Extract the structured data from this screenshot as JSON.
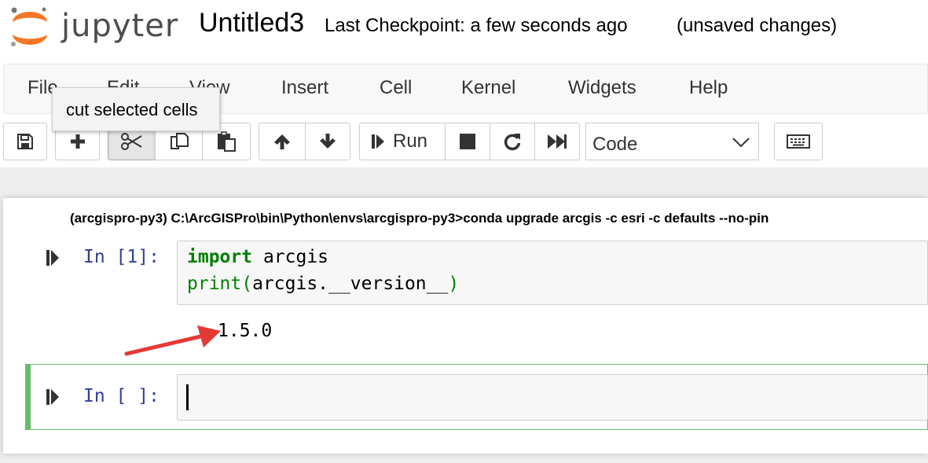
{
  "header": {
    "logo_text": "jupyter",
    "notebook_title": "Untitled3",
    "checkpoint_text": "Last Checkpoint: a few seconds ago",
    "unsaved_text": "(unsaved changes)"
  },
  "menu": {
    "items": [
      "File",
      "Edit",
      "View",
      "Insert",
      "Cell",
      "Kernel",
      "Widgets",
      "Help"
    ]
  },
  "tooltip": "cut selected cells",
  "toolbar": {
    "run_label": "Run",
    "cell_type": "Code",
    "icons": [
      "save-icon",
      "plus-icon",
      "scissors-icon",
      "copy-icon",
      "paste-icon",
      "arrow-up-icon",
      "arrow-down-icon",
      "step-forward-icon",
      "stop-icon",
      "restart-icon",
      "fast-forward-icon",
      "chevron-down-icon",
      "keyboard-icon"
    ]
  },
  "caption": "(arcgispro-py3) C:\\ArcGISPro\\bin\\Python\\envs\\arcgispro-py3>conda upgrade arcgis -c esri -c defaults --no-pin",
  "cells": [
    {
      "prompt": "In [1]:",
      "lines": [
        {
          "keyword": "import",
          "rest": " arcgis"
        },
        {
          "builtin": "print(",
          "rest": "arcgis.__version__",
          "close": ")"
        }
      ],
      "output": "1.5.0"
    },
    {
      "prompt": "In [ ]:",
      "lines": []
    }
  ],
  "colors": {
    "accent_arrow": "#e53935",
    "selected_border": "#66bb6a",
    "prompt_blue": "#303f9f",
    "keyword_green": "#008000",
    "logo_orange": "#f37726"
  }
}
